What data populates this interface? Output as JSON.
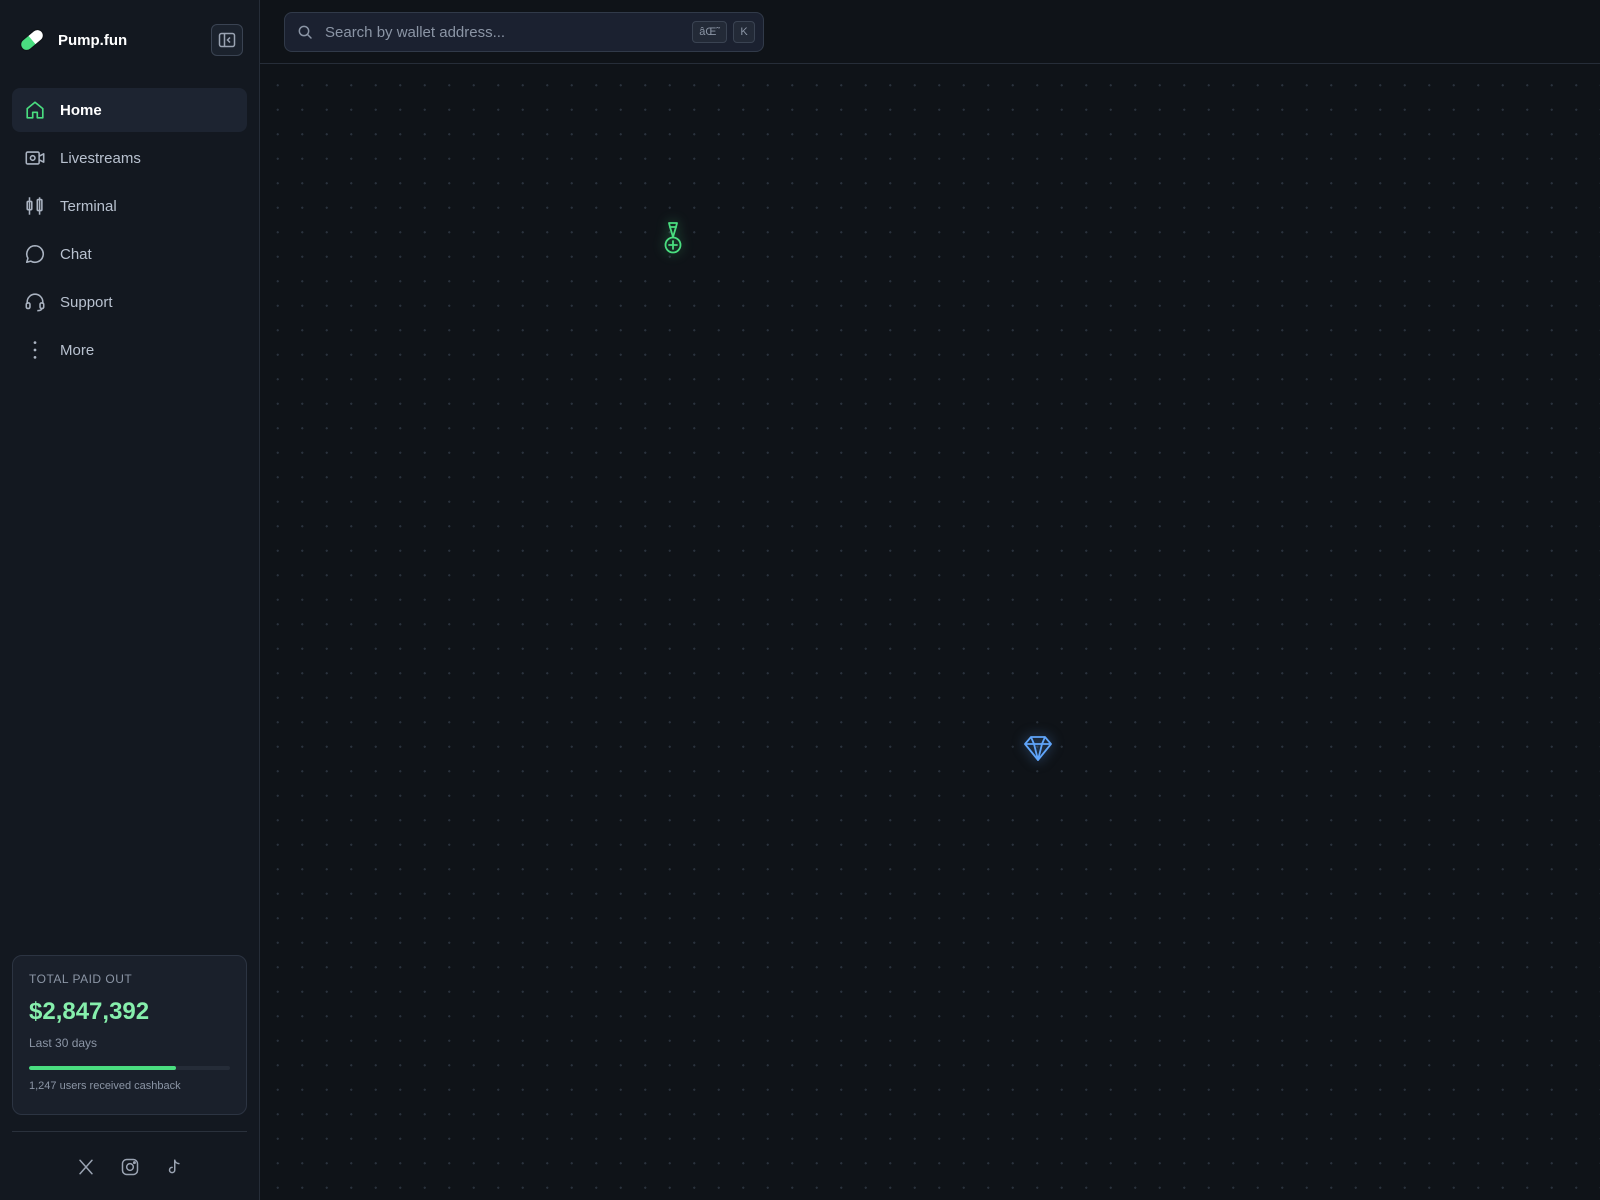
{
  "app": {
    "name": "Pump.fun"
  },
  "sidebar": {
    "items": [
      {
        "label": "Home",
        "icon": "home-icon",
        "active": true
      },
      {
        "label": "Livestreams",
        "icon": "video-camera-icon",
        "active": false
      },
      {
        "label": "Terminal",
        "icon": "candlestick-icon",
        "active": false
      },
      {
        "label": "Chat",
        "icon": "chat-bubble-icon",
        "active": false
      },
      {
        "label": "Support",
        "icon": "headset-icon",
        "active": false
      },
      {
        "label": "More",
        "icon": "more-vertical-icon",
        "active": false
      }
    ],
    "payout": {
      "label": "TOTAL PAID OUT",
      "amount": "$2,847,392",
      "period": "Last 30 days",
      "progress": 0.73,
      "users_text": "1,247 users received cashback"
    },
    "socials": [
      "x-icon",
      "instagram-icon",
      "tiktok-icon"
    ]
  },
  "search": {
    "placeholder": "Search by wallet address...",
    "shortcut_modifier": "âŒ˜",
    "shortcut_key": "K"
  },
  "colors": {
    "accent_green": "#4ade80",
    "accent_blue": "#60a5fa",
    "background": "#0f1318",
    "sidebar": "#131820"
  },
  "map_markers": [
    {
      "icon": "medal-icon",
      "color": "green"
    },
    {
      "icon": "diamond-icon",
      "color": "blue"
    }
  ]
}
